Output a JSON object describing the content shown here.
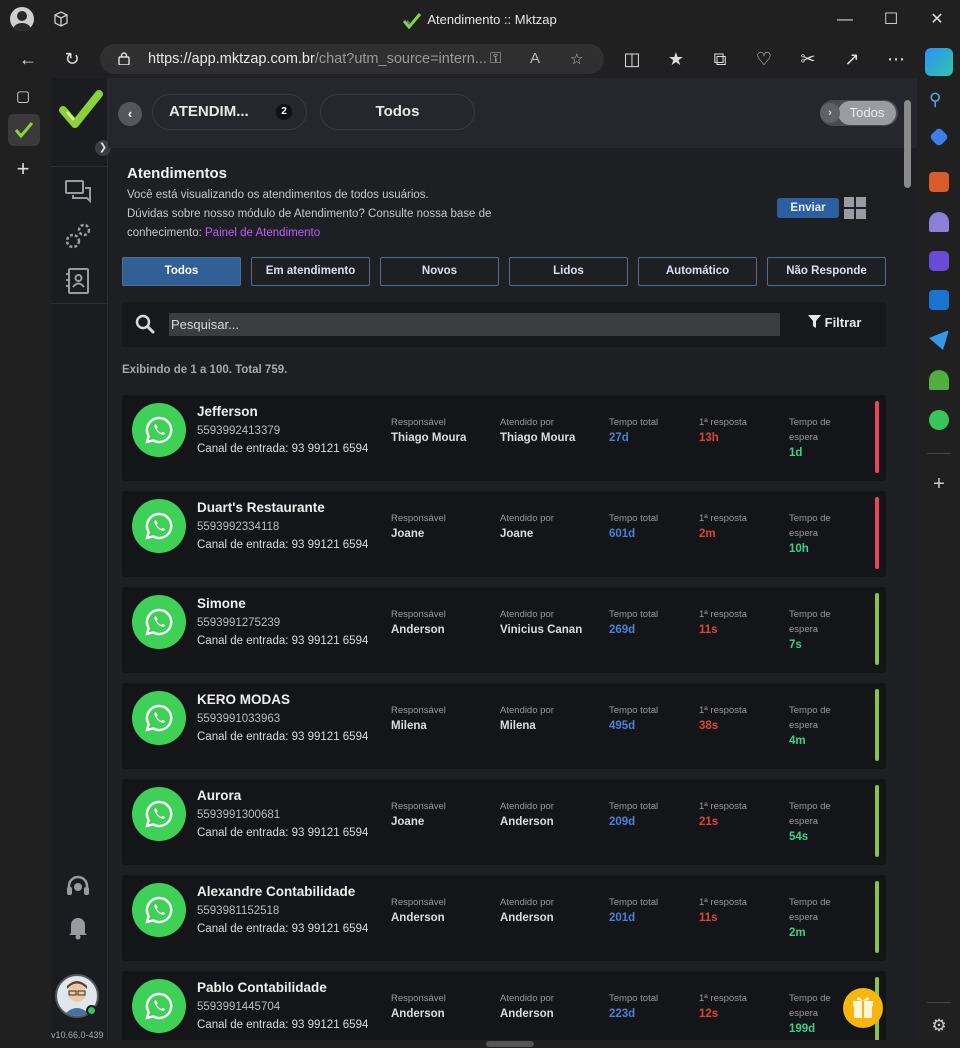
{
  "browser": {
    "window_title": "Atendimento :: Mktzap",
    "url_host": "https://app.mktzap.com.br",
    "url_path": "/chat?utm_source=intern..."
  },
  "app": {
    "version": "v10.66.0-439",
    "tabs": [
      {
        "label": "ATENDIM...",
        "badge": "2"
      },
      {
        "label": "Todos"
      }
    ],
    "toggle_label": "Todos"
  },
  "header": {
    "title": "Atendimentos",
    "desc_line1": "Você está visualizando os atendimentos de todos usuários.",
    "desc_line2": "Dúvidas sobre nosso módulo de Atendimento? Consulte nossa base de conhecimento:",
    "link": "Painel de Atendimento",
    "send_label": "Enviar"
  },
  "filters": [
    "Todos",
    "Em atendimento",
    "Novos",
    "Lidos",
    "Automático",
    "Não Responde"
  ],
  "search": {
    "placeholder": "Pesquisar...",
    "filter_label": "Filtrar"
  },
  "count_text": "Exibindo de 1 a 100. Total 759.",
  "labels": {
    "responsavel": "Responsável",
    "atendido": "Atendido por",
    "tempo_total": "Tempo total",
    "primeira": "1ª resposta",
    "espera_1": "Tempo de",
    "espera_2": "espera"
  },
  "colors": {
    "accent": "#2f5f94",
    "whatsapp": "#3fd058",
    "red_bar": "#e8455a",
    "green_bar": "#8bc34a"
  },
  "items": [
    {
      "name": "Jefferson",
      "phone": "5593992413379",
      "canal": "Canal de entrada: 93 99121 6594",
      "responsavel": "Thiago Moura",
      "atendido": "Thiago Moura",
      "total": "27d",
      "primeira": "13h",
      "espera": "1d",
      "status": "red"
    },
    {
      "name": "Duart's Restaurante",
      "phone": "5593992334118",
      "canal": "Canal de entrada: 93 99121 6594",
      "responsavel": "Joane",
      "atendido": "Joane",
      "total": "601d",
      "primeira": "2m",
      "espera": "10h",
      "status": "red"
    },
    {
      "name": "Simone",
      "phone": "5593991275239",
      "canal": "Canal de entrada: 93 99121 6594",
      "responsavel": "Anderson",
      "atendido": "Vinicius Canan",
      "total": "269d",
      "primeira": "11s",
      "espera": "7s",
      "status": "green"
    },
    {
      "name": "KERO MODAS",
      "phone": "5593991033963",
      "canal": "Canal de entrada: 93 99121 6594",
      "responsavel": "Milena",
      "atendido": "Milena",
      "total": "495d",
      "primeira": "38s",
      "espera": "4m",
      "status": "green"
    },
    {
      "name": "Aurora",
      "phone": "5593991300681",
      "canal": "Canal de entrada: 93 99121 6594",
      "responsavel": "Joane",
      "atendido": "Anderson",
      "total": "209d",
      "primeira": "21s",
      "espera": "54s",
      "status": "green"
    },
    {
      "name": "Alexandre Contabilidade",
      "phone": "5593981152518",
      "canal": "Canal de entrada: 93 99121 6594",
      "responsavel": "Anderson",
      "atendido": "Anderson",
      "total": "201d",
      "primeira": "11s",
      "espera": "2m",
      "status": "green"
    },
    {
      "name": "Pablo Contabilidade",
      "phone": "5593991445704",
      "canal": "Canal de entrada: 93 99121 6594",
      "responsavel": "Anderson",
      "atendido": "Anderson",
      "total": "223d",
      "primeira": "12s",
      "espera": "199d",
      "status": "green"
    }
  ]
}
